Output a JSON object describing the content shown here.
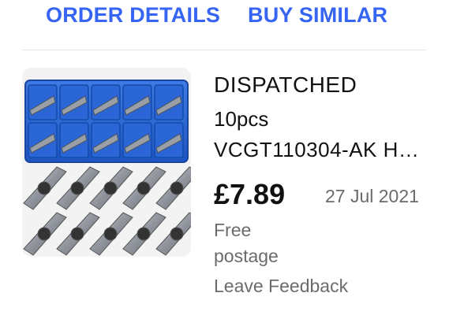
{
  "actions": {
    "order_details": "ORDER DETAILS",
    "buy_similar": "BUY SIMILAR"
  },
  "order": {
    "status": "DISPATCHED",
    "quantity": "10pcs",
    "title": "VCGT110304-AK H…",
    "price": "£7.89",
    "date": "27 Jul 2021",
    "postage_line1": "Free",
    "postage_line2": "postage",
    "feedback_label": "Leave Feedback"
  },
  "colors": {
    "link": "#3665f3",
    "muted": "#6b6b6b",
    "text": "#111111"
  }
}
